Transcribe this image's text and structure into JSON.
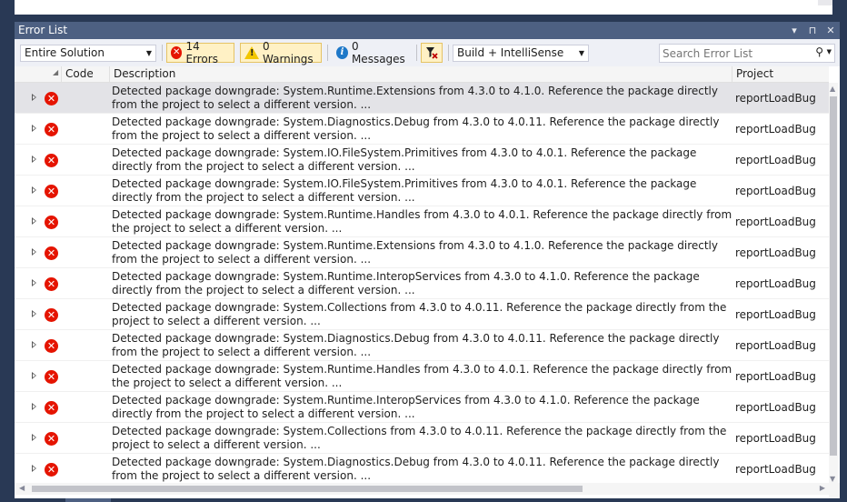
{
  "panel": {
    "title": "Error List",
    "title_buttons": {
      "dropdown": "▾",
      "pin": "⊓",
      "close": "✕"
    }
  },
  "toolbar": {
    "scope": {
      "value": "Entire Solution"
    },
    "errors_label": "14 Errors",
    "warnings_label": "0 Warnings",
    "messages_label": "0 Messages",
    "source": {
      "value": "Build + IntelliSense"
    },
    "search": {
      "placeholder": "Search Error List"
    }
  },
  "columns": {
    "code": "Code",
    "description": "Description",
    "project": "Project"
  },
  "rows": [
    {
      "description": "Detected package downgrade: System.Runtime.Extensions from 4.3.0 to 4.1.0. Reference the package directly from the project to select a different version.  ...",
      "project": "reportLoadBug"
    },
    {
      "description": "Detected package downgrade: System.Diagnostics.Debug from 4.3.0 to 4.0.11. Reference the package directly from the project to select a different version.  ...",
      "project": "reportLoadBug"
    },
    {
      "description": "Detected package downgrade: System.IO.FileSystem.Primitives from 4.3.0 to 4.0.1. Reference the package directly from the project to select a different version.  ...",
      "project": "reportLoadBug"
    },
    {
      "description": "Detected package downgrade: System.IO.FileSystem.Primitives from 4.3.0 to 4.0.1. Reference the package directly from the project to select a different version.  ...",
      "project": "reportLoadBug"
    },
    {
      "description": "Detected package downgrade: System.Runtime.Handles from 4.3.0 to 4.0.1. Reference the package directly from the project to select a different version.  ...",
      "project": "reportLoadBug"
    },
    {
      "description": "Detected package downgrade: System.Runtime.Extensions from 4.3.0 to 4.1.0. Reference the package directly from the project to select a different version.  ...",
      "project": "reportLoadBug"
    },
    {
      "description": "Detected package downgrade: System.Runtime.InteropServices from 4.3.0 to 4.1.0. Reference the package directly from the project to select a different version.  ...",
      "project": "reportLoadBug"
    },
    {
      "description": "Detected package downgrade: System.Collections from 4.3.0 to 4.0.11. Reference the package directly from the project to select a different version.  ...",
      "project": "reportLoadBug"
    },
    {
      "description": "Detected package downgrade: System.Diagnostics.Debug from 4.3.0 to 4.0.11. Reference the package directly from the project to select a different version.  ...",
      "project": "reportLoadBug"
    },
    {
      "description": "Detected package downgrade: System.Runtime.Handles from 4.3.0 to 4.0.1. Reference the package directly from the project to select a different version.  ...",
      "project": "reportLoadBug"
    },
    {
      "description": "Detected package downgrade: System.Runtime.InteropServices from 4.3.0 to 4.1.0. Reference the package directly from the project to select a different version.  ...",
      "project": "reportLoadBug"
    },
    {
      "description": "Detected package downgrade: System.Collections from 4.3.0 to 4.0.11. Reference the package directly from the project to select a different version.  ...",
      "project": "reportLoadBug"
    },
    {
      "description": "Detected package downgrade: System.Diagnostics.Debug from 4.3.0 to 4.0.11. Reference the package directly from the project to select a different version.  ...",
      "project": "reportLoadBug"
    }
  ],
  "icons": {
    "error": "error-icon",
    "warning": "warning-icon",
    "info": "info-icon",
    "filter": "filter-icon",
    "search": "search-icon",
    "expand": "expand-arrow-icon"
  },
  "colors": {
    "title_bar": "#4d6082",
    "error": "#e51400",
    "warning": "#f2c600",
    "info": "#1e78c8",
    "checked_button": "#fff1c5",
    "selected_row": "#e3e3e7"
  }
}
